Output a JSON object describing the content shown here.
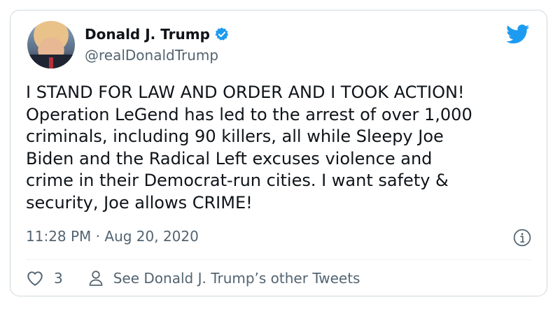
{
  "author": {
    "name": "Donald J. Trump",
    "handle": "@realDonaldTrump"
  },
  "tweet": {
    "text": "I STAND FOR LAW AND ORDER AND I TOOK ACTION!\nOperation LeGend has led to the arrest of over 1,000\ncriminals, including 90 killers, all while Sleepy Joe\nBiden and the Radical Left excuses violence and\ncrime in their Democrat-run cities. I want safety &\nsecurity, Joe allows CRIME!",
    "timestamp": "11:28 PM · Aug 20, 2020"
  },
  "footer": {
    "like_count": "3",
    "see_more": "See Donald J. Trump’s other Tweets"
  },
  "icons": {
    "verified": "verified-badge-icon",
    "brand": "twitter-bird-icon",
    "info": "info-icon",
    "like": "heart-icon",
    "profile": "person-icon"
  },
  "colors": {
    "brand": "#1d9bf0",
    "text": "#0f1419",
    "muted": "#536471",
    "border": "#cfd9de"
  }
}
